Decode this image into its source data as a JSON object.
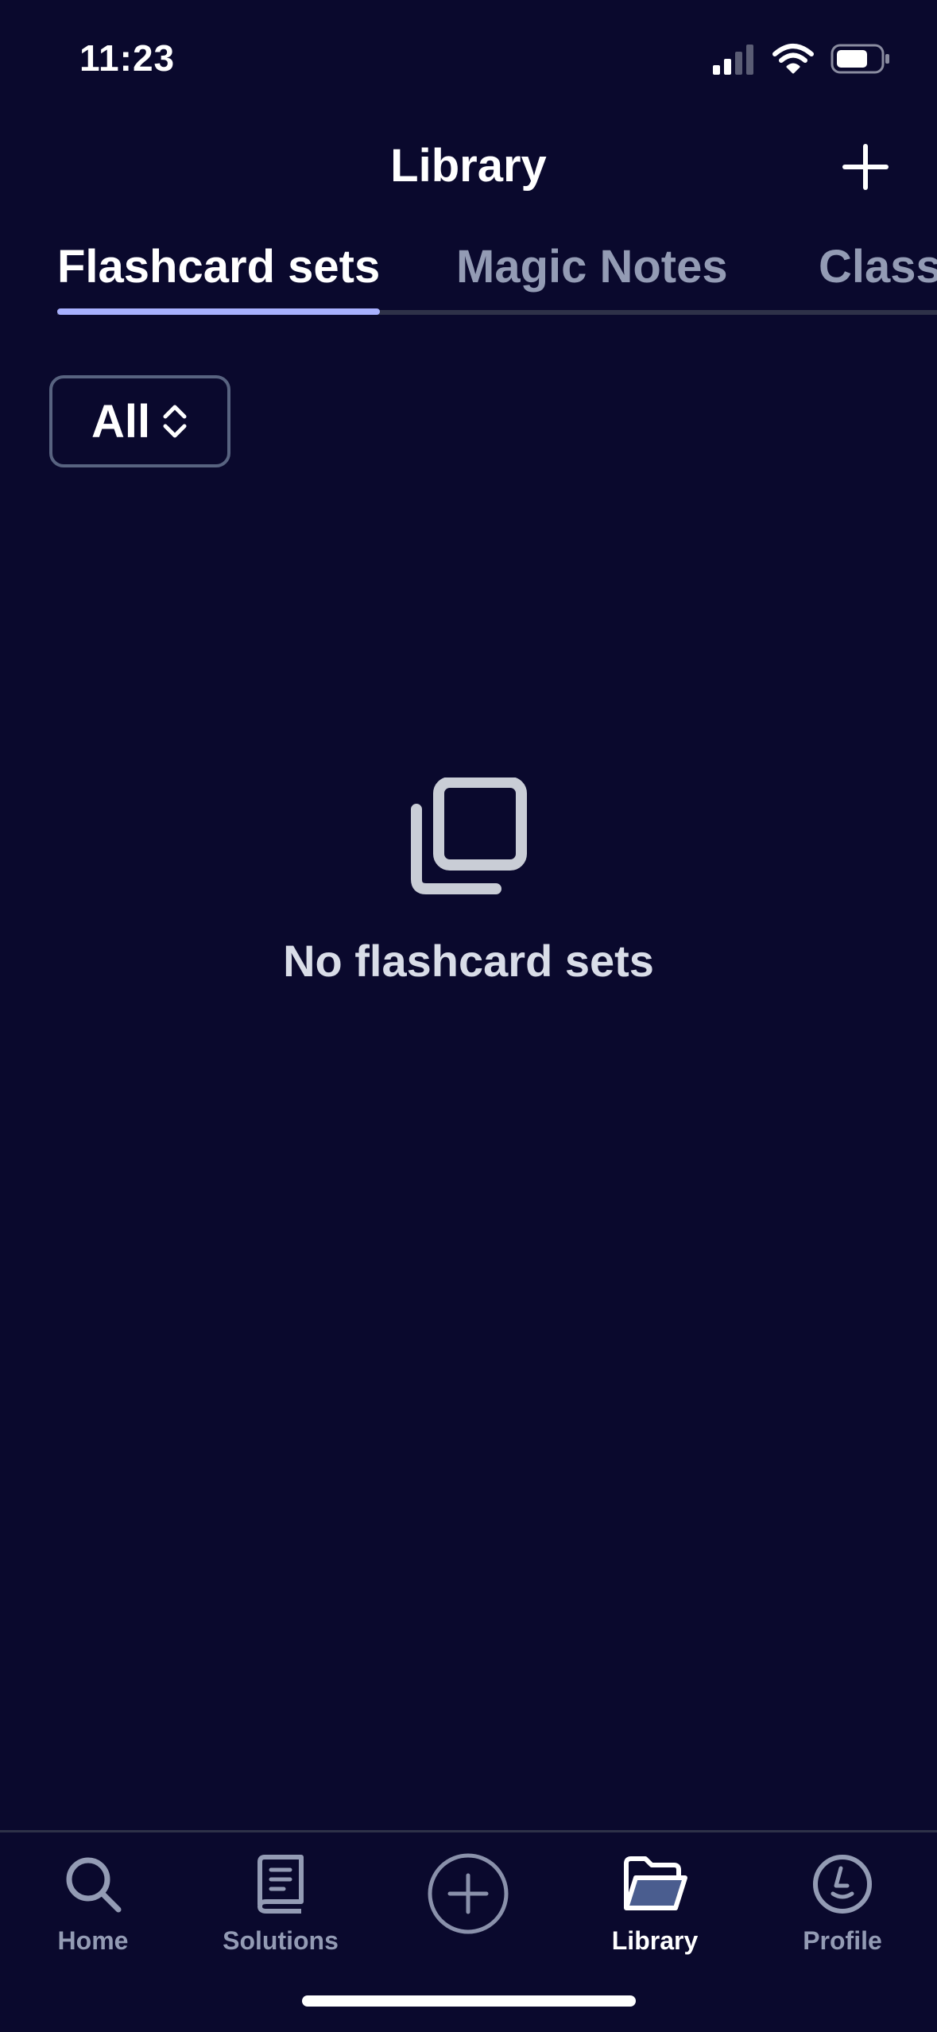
{
  "status_bar": {
    "time": "11:23"
  },
  "header": {
    "title": "Library"
  },
  "tabs": [
    {
      "label": "Flashcard sets",
      "active": true
    },
    {
      "label": "Magic Notes",
      "active": false
    },
    {
      "label": "Classes",
      "active": false
    }
  ],
  "filter": {
    "label": "All"
  },
  "empty_state": {
    "message": "No flashcard sets"
  },
  "tab_bar": {
    "items": [
      {
        "label": "Home",
        "icon": "search-icon"
      },
      {
        "label": "Solutions",
        "icon": "book-icon"
      },
      {
        "label": "",
        "icon": "plus-circle-icon"
      },
      {
        "label": "Library",
        "icon": "folder-icon",
        "active": true
      },
      {
        "label": "Profile",
        "icon": "avatar-icon"
      }
    ]
  },
  "colors": {
    "background": "#0a092d",
    "tab_indicator": "#a8b1ff",
    "inactive_text": "#939bb4",
    "border": "#586380"
  }
}
